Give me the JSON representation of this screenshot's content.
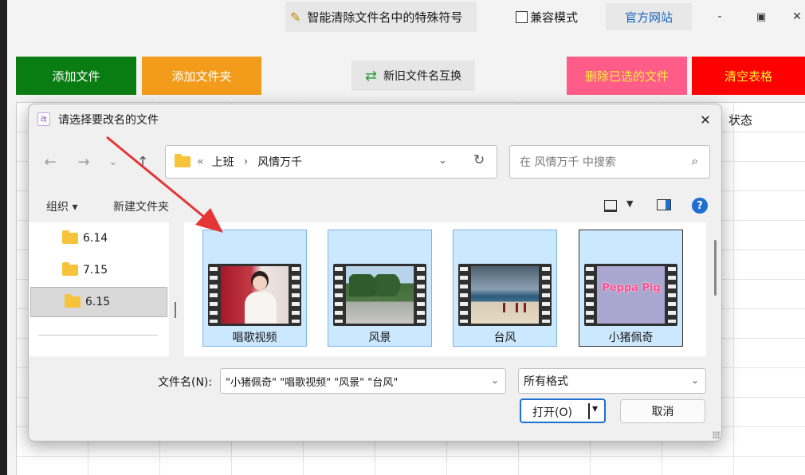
{
  "app": {
    "title_label": "智能清除文件名中的特殊符号",
    "compat_label": "兼容模式",
    "official_site_label": "官方网站",
    "win_min": "-",
    "win_max": "▣",
    "win_close": "✕",
    "buttons": {
      "add_file": "添加文件",
      "add_folder": "添加文件夹",
      "swap_names": "新旧文件名互换",
      "delete_selected": "删除已选的文件",
      "clear_table": "清空表格"
    },
    "table_status_header": "状态",
    "colors": {
      "green": "#0a7d12",
      "orange": "#f39c1b",
      "pink": "#ff5c8a",
      "red": "#ff0000"
    }
  },
  "dialog": {
    "title": "请选择要改名的文件",
    "close_glyph": "✕",
    "nav": {
      "back": "←",
      "forward": "→",
      "recent": "⌄",
      "up": "↑"
    },
    "address": {
      "prefix": "«",
      "crumbs": [
        "上班",
        "风情万千"
      ],
      "sep": "›"
    },
    "search_placeholder": "在 风情万千 中搜索",
    "toolbar": {
      "organize": "组织 ▾",
      "new_folder": "新建文件夹"
    },
    "help_glyph": "?",
    "tree": [
      {
        "label": "6.14",
        "selected": false
      },
      {
        "label": "7.15",
        "selected": false
      },
      {
        "label": "6.15",
        "selected": true
      }
    ],
    "files": [
      {
        "name": "唱歌视频"
      },
      {
        "name": "风景"
      },
      {
        "name": "台风"
      },
      {
        "name": "小猪佩奇"
      }
    ],
    "thumb_text": "Peppa Pig",
    "filename_label": "文件名(N):",
    "filename_value": "\"小猪佩奇\" \"唱歌视频\" \"风景\" \"台风\"",
    "filter_value": "所有格式",
    "open_label": "打开(O)",
    "open_arrow": "▾",
    "cancel_label": "取消"
  }
}
